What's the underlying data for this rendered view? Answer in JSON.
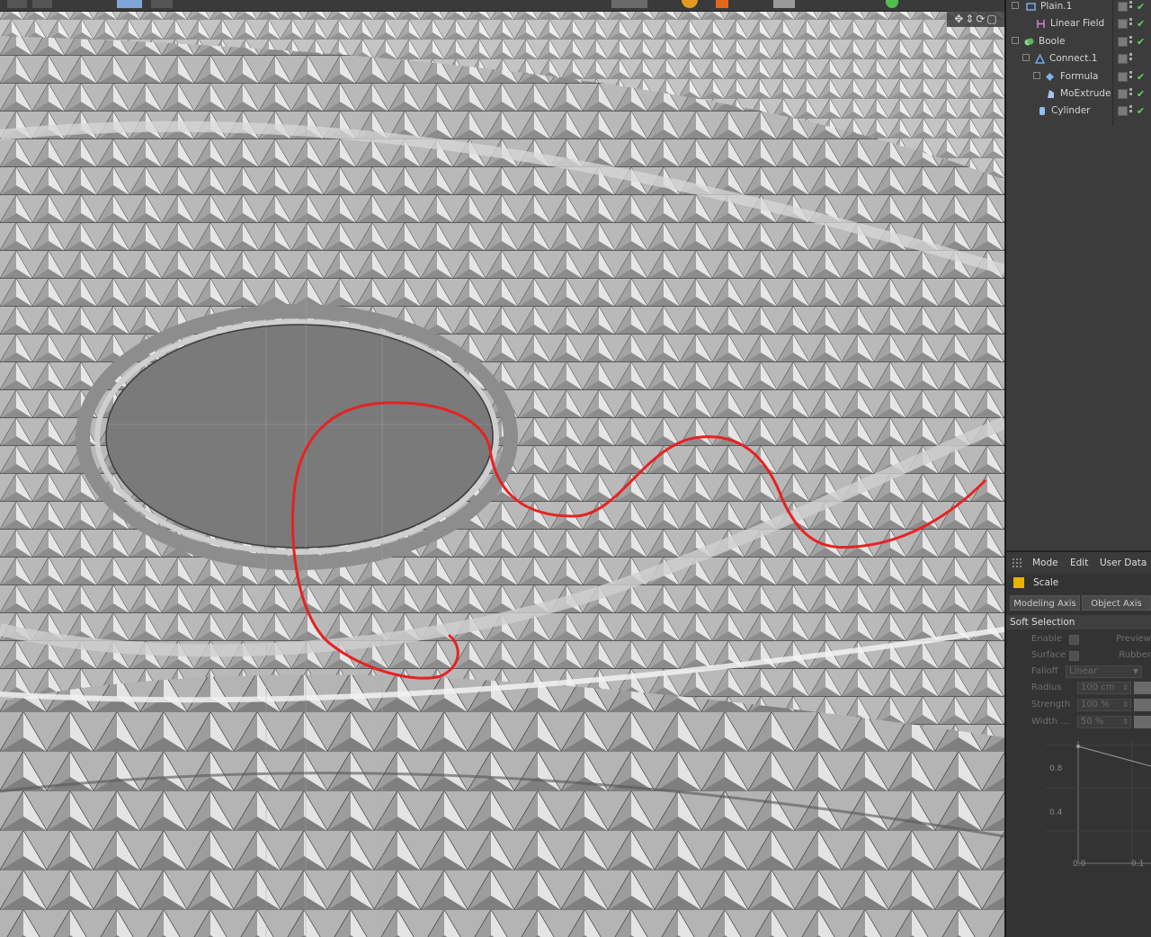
{
  "colors": {
    "annotation": "#e82121",
    "panel_bg": "#3c3c3c",
    "check": "#5cd85c",
    "accent_icon": "#e7b400"
  },
  "objects": [
    {
      "name": "Plain.1",
      "icon": "plain-icon"
    },
    {
      "name": "Linear Field",
      "icon": "linear-field-icon"
    },
    {
      "name": "Boole",
      "icon": "boole-icon"
    },
    {
      "name": "Connect.1",
      "icon": "connect-icon"
    },
    {
      "name": "Formula",
      "icon": "formula-icon"
    },
    {
      "name": "MoExtrude",
      "icon": "moextrude-icon"
    },
    {
      "name": "Cylinder",
      "icon": "cylinder-icon"
    }
  ],
  "attributes": {
    "tabs": [
      "Mode",
      "Edit",
      "User Data"
    ],
    "title": "Scale",
    "subtabs": [
      "Modeling Axis",
      "Object Axis"
    ],
    "section": "Soft Selection",
    "props": {
      "enable": "Enable",
      "preview": "Preview",
      "surface": "Surface",
      "rubber": "Rubber",
      "falloff_label": "Falloff",
      "falloff_value": "Linear",
      "radius_label": "Radius",
      "radius_value": "100 cm",
      "strength_label": "Strength",
      "strength_value": "100 %",
      "width_label": "Width ...",
      "width_value": "50 %"
    },
    "graph": {
      "y_labels": [
        "0.8",
        "0.4"
      ],
      "x_labels": [
        "0.0",
        "0.1"
      ]
    }
  }
}
